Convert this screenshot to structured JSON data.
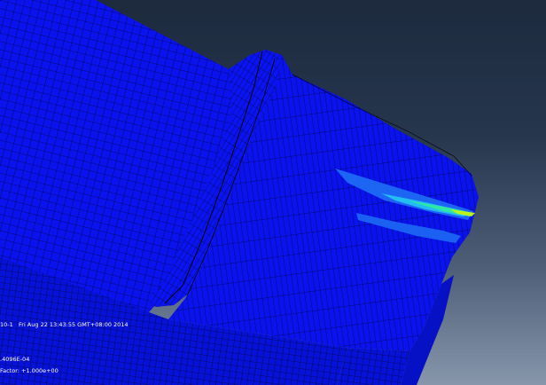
{
  "viewport": {
    "label_step": "10-1",
    "label_timestamp": "Fri Aug 22 13:43:55 GMT+08:00 2014",
    "label_increment": ".4096E-04",
    "label_deformation": "Factor: +1.000e+00"
  },
  "colors": {
    "mesh_fill": "#0a12ee",
    "mesh_fill_dark": "#0610c4",
    "mesh_lines": "#000000",
    "contour_light_blue": "#1e6ff5",
    "contour_cyan": "#23bdf2",
    "contour_green": "#2fe8a6",
    "contour_yellow_green": "#b9f21f",
    "background_top": "#1d2a3e",
    "background_bottom": "#8796ab"
  }
}
